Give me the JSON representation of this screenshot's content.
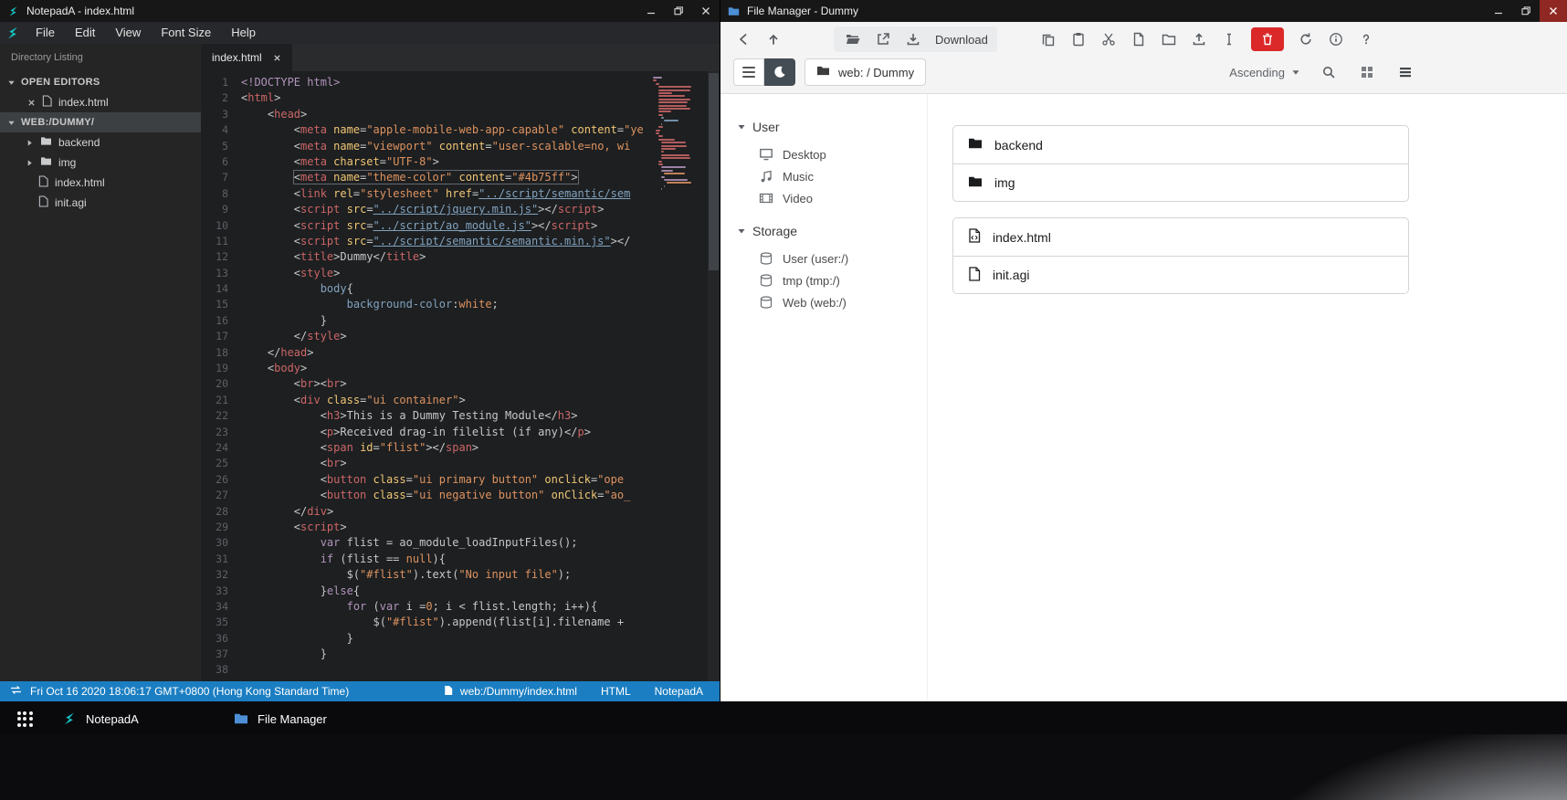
{
  "colors": {
    "statusbar_blue": "#1b7ec2",
    "danger_red": "#db2828",
    "logo_teal": "#14c4c6",
    "fm_folder_blue": "#4c8fd6",
    "token": {
      "p": "#c5c8c6",
      "tag": "#cc6666",
      "attr": "#f0c674",
      "str": "#de935f",
      "link": "#81a2be",
      "kw": "#b294bb",
      "num": "#de935f",
      "prop": "#81a2be",
      "dt": "#b294bb"
    }
  },
  "notepad": {
    "window_title": "NotepadA - index.html",
    "menu": {
      "file": "File",
      "edit": "Edit",
      "view": "View",
      "font_size": "Font Size",
      "help": "Help"
    },
    "sidebar": {
      "header": "Directory Listing",
      "open_editors": "OPEN EDITORS",
      "open_file": "index.html",
      "workspace": "WEB:/DUMMY/",
      "tree": [
        {
          "name": "backend"
        },
        {
          "name": "img"
        },
        {
          "name": "index.html"
        },
        {
          "name": "init.agi"
        }
      ]
    },
    "tab": "index.html",
    "status": {
      "time": "Fri Oct 16 2020 18:06:17 GMT+0800 (Hong Kong Standard Time)",
      "path": "web:/Dummy/index.html",
      "mode": "HTML",
      "app": "NotepadA"
    },
    "code": {
      "lines": [
        {
          "t": [
            [
              "dt",
              "<!DOCTYPE html>"
            ]
          ]
        },
        {
          "t": [
            [
              "p",
              "<"
            ],
            [
              "tag",
              "html"
            ],
            [
              "p",
              ">"
            ]
          ]
        },
        {
          "t": [
            [
              "p",
              "    <"
            ],
            [
              "tag",
              "head"
            ],
            [
              "p",
              ">"
            ]
          ]
        },
        {
          "t": [
            [
              "p",
              "        <"
            ],
            [
              "tag",
              "meta"
            ],
            [
              "p",
              " "
            ],
            [
              "attr",
              "name"
            ],
            [
              "p",
              "="
            ],
            [
              "str",
              "\"apple-mobile-web-app-capable\""
            ],
            [
              "p",
              " "
            ],
            [
              "attr",
              "content"
            ],
            [
              "p",
              "="
            ],
            [
              "str",
              "\"ye"
            ]
          ]
        },
        {
          "t": [
            [
              "p",
              "        <"
            ],
            [
              "tag",
              "meta"
            ],
            [
              "p",
              " "
            ],
            [
              "attr",
              "name"
            ],
            [
              "p",
              "="
            ],
            [
              "str",
              "\"viewport\""
            ],
            [
              "p",
              " "
            ],
            [
              "attr",
              "content"
            ],
            [
              "p",
              "="
            ],
            [
              "str",
              "\"user-scalable=no, wi"
            ]
          ]
        },
        {
          "t": [
            [
              "p",
              "        <"
            ],
            [
              "tag",
              "meta"
            ],
            [
              "p",
              " "
            ],
            [
              "attr",
              "charset"
            ],
            [
              "p",
              "="
            ],
            [
              "str",
              "\"UTF-8\""
            ],
            [
              "p",
              ">"
            ]
          ]
        },
        {
          "hl": true,
          "t": [
            [
              "p",
              "        "
            ],
            [
              "p",
              "<"
            ],
            [
              "tag",
              "meta"
            ],
            [
              "p",
              " "
            ],
            [
              "attr",
              "name"
            ],
            [
              "p",
              "="
            ],
            [
              "str",
              "\"theme-color\""
            ],
            [
              "p",
              " "
            ],
            [
              "attr",
              "content"
            ],
            [
              "p",
              "="
            ],
            [
              "str",
              "\"#4b75ff\""
            ],
            [
              "p",
              ">"
            ]
          ]
        },
        {
          "t": [
            [
              "p",
              "        <"
            ],
            [
              "tag",
              "link"
            ],
            [
              "p",
              " "
            ],
            [
              "attr",
              "rel"
            ],
            [
              "p",
              "="
            ],
            [
              "str",
              "\"stylesheet\""
            ],
            [
              "p",
              " "
            ],
            [
              "attr",
              "href"
            ],
            [
              "p",
              "="
            ],
            [
              "link",
              "\"../script/semantic/sem"
            ]
          ]
        },
        {
          "t": [
            [
              "p",
              "        <"
            ],
            [
              "tag",
              "script"
            ],
            [
              "p",
              " "
            ],
            [
              "attr",
              "src"
            ],
            [
              "p",
              "="
            ],
            [
              "link",
              "\"../script/jquery.min.js\""
            ],
            [
              "p",
              "></"
            ],
            [
              "tag",
              "script"
            ],
            [
              "p",
              ">"
            ]
          ]
        },
        {
          "t": [
            [
              "p",
              "        <"
            ],
            [
              "tag",
              "script"
            ],
            [
              "p",
              " "
            ],
            [
              "attr",
              "src"
            ],
            [
              "p",
              "="
            ],
            [
              "link",
              "\"../script/ao_module.js\""
            ],
            [
              "p",
              "></"
            ],
            [
              "tag",
              "script"
            ],
            [
              "p",
              ">"
            ]
          ]
        },
        {
          "t": [
            [
              "p",
              "        <"
            ],
            [
              "tag",
              "script"
            ],
            [
              "p",
              " "
            ],
            [
              "attr",
              "src"
            ],
            [
              "p",
              "="
            ],
            [
              "link",
              "\"../script/semantic/semantic.min.js\""
            ],
            [
              "p",
              "></"
            ]
          ]
        },
        {
          "t": [
            [
              "p",
              "        <"
            ],
            [
              "tag",
              "title"
            ],
            [
              "p",
              ">Dummy</"
            ],
            [
              "tag",
              "title"
            ],
            [
              "p",
              ">"
            ]
          ]
        },
        {
          "t": [
            [
              "p",
              "        <"
            ],
            [
              "tag",
              "style"
            ],
            [
              "p",
              ">"
            ]
          ]
        },
        {
          "t": [
            [
              "p",
              "            "
            ],
            [
              "prop",
              "body"
            ],
            [
              "p",
              "{"
            ]
          ]
        },
        {
          "t": [
            [
              "p",
              "                "
            ],
            [
              "prop",
              "background-color"
            ],
            [
              "p",
              ":"
            ],
            [
              "num",
              "white"
            ],
            [
              "p",
              ";"
            ]
          ]
        },
        {
          "t": [
            [
              "p",
              "            }"
            ]
          ]
        },
        {
          "t": [
            [
              "p",
              "        </"
            ],
            [
              "tag",
              "style"
            ],
            [
              "p",
              ">"
            ]
          ]
        },
        {
          "t": [
            [
              "p",
              "    </"
            ],
            [
              "tag",
              "head"
            ],
            [
              "p",
              ">"
            ]
          ]
        },
        {
          "t": [
            [
              "p",
              "    <"
            ],
            [
              "tag",
              "body"
            ],
            [
              "p",
              ">"
            ]
          ]
        },
        {
          "t": [
            [
              "p",
              "        <"
            ],
            [
              "tag",
              "br"
            ],
            [
              "p",
              "><"
            ],
            [
              "tag",
              "br"
            ],
            [
              "p",
              ">"
            ]
          ]
        },
        {
          "t": [
            [
              "p",
              "        <"
            ],
            [
              "tag",
              "div"
            ],
            [
              "p",
              " "
            ],
            [
              "attr",
              "class"
            ],
            [
              "p",
              "="
            ],
            [
              "str",
              "\"ui container\""
            ],
            [
              "p",
              ">"
            ]
          ]
        },
        {
          "t": [
            [
              "p",
              "            <"
            ],
            [
              "tag",
              "h3"
            ],
            [
              "p",
              ">This is a Dummy Testing Module</"
            ],
            [
              "tag",
              "h3"
            ],
            [
              "p",
              ">"
            ]
          ]
        },
        {
          "t": [
            [
              "p",
              "            <"
            ],
            [
              "tag",
              "p"
            ],
            [
              "p",
              ">Received drag-in filelist (if any)</"
            ],
            [
              "tag",
              "p"
            ],
            [
              "p",
              ">"
            ]
          ]
        },
        {
          "t": [
            [
              "p",
              "            <"
            ],
            [
              "tag",
              "span"
            ],
            [
              "p",
              " "
            ],
            [
              "attr",
              "id"
            ],
            [
              "p",
              "="
            ],
            [
              "str",
              "\"flist\""
            ],
            [
              "p",
              "></"
            ],
            [
              "tag",
              "span"
            ],
            [
              "p",
              ">"
            ]
          ]
        },
        {
          "t": [
            [
              "p",
              "            <"
            ],
            [
              "tag",
              "br"
            ],
            [
              "p",
              ">"
            ]
          ]
        },
        {
          "t": [
            [
              "p",
              "            <"
            ],
            [
              "tag",
              "button"
            ],
            [
              "p",
              " "
            ],
            [
              "attr",
              "class"
            ],
            [
              "p",
              "="
            ],
            [
              "str",
              "\"ui primary button\""
            ],
            [
              "p",
              " "
            ],
            [
              "attr",
              "onclick"
            ],
            [
              "p",
              "="
            ],
            [
              "str",
              "\"ope"
            ]
          ]
        },
        {
          "t": [
            [
              "p",
              "            <"
            ],
            [
              "tag",
              "button"
            ],
            [
              "p",
              " "
            ],
            [
              "attr",
              "class"
            ],
            [
              "p",
              "="
            ],
            [
              "str",
              "\"ui negative button\""
            ],
            [
              "p",
              " "
            ],
            [
              "attr",
              "onClick"
            ],
            [
              "p",
              "="
            ],
            [
              "str",
              "\"ao_"
            ]
          ]
        },
        {
          "t": [
            [
              "p",
              "        </"
            ],
            [
              "tag",
              "div"
            ],
            [
              "p",
              ">"
            ]
          ]
        },
        {
          "t": [
            [
              "p",
              "        <"
            ],
            [
              "tag",
              "script"
            ],
            [
              "p",
              ">"
            ]
          ]
        },
        {
          "t": [
            [
              "p",
              "            "
            ],
            [
              "kw",
              "var"
            ],
            [
              "p",
              " flist = ao_module_loadInputFiles();"
            ]
          ]
        },
        {
          "t": [
            [
              "p",
              "            "
            ],
            [
              "kw",
              "if"
            ],
            [
              "p",
              " (flist == "
            ],
            [
              "num",
              "null"
            ],
            [
              "p",
              "){"
            ]
          ]
        },
        {
          "t": [
            [
              "p",
              "                $("
            ],
            [
              "str",
              "\"#flist\""
            ],
            [
              "p",
              ").text("
            ],
            [
              "str",
              "\"No input file\""
            ],
            [
              "p",
              ");"
            ]
          ]
        },
        {
          "t": [
            [
              "p",
              "            }"
            ],
            [
              "kw",
              "else"
            ],
            [
              "p",
              "{"
            ]
          ]
        },
        {
          "t": [
            [
              "p",
              "                "
            ],
            [
              "kw",
              "for"
            ],
            [
              "p",
              " ("
            ],
            [
              "kw",
              "var"
            ],
            [
              "p",
              " i ="
            ],
            [
              "num",
              "0"
            ],
            [
              "p",
              "; i < flist.length; i++){"
            ]
          ]
        },
        {
          "t": [
            [
              "p",
              "                    $("
            ],
            [
              "str",
              "\"#flist\""
            ],
            [
              "p",
              ").append(flist[i].filename + "
            ]
          ]
        },
        {
          "t": [
            [
              "p",
              "                }"
            ]
          ]
        },
        {
          "t": [
            [
              "p",
              "            }"
            ]
          ]
        },
        {
          "t": []
        }
      ]
    }
  },
  "filemanager": {
    "window_title": "File Manager - Dummy",
    "toolbar": {
      "download": "Download"
    },
    "breadcrumb": "web: / Dummy",
    "sort": "Ascending",
    "nav": {
      "user_label": "User",
      "user_items": [
        {
          "label": "Desktop",
          "icon": "desktop-icon"
        },
        {
          "label": "Music",
          "icon": "music-icon"
        },
        {
          "label": "Video",
          "icon": "video-icon"
        }
      ],
      "storage_label": "Storage",
      "storage_items": [
        {
          "label": "User (user:/)",
          "icon": "disk-icon"
        },
        {
          "label": "tmp (tmp:/)",
          "icon": "disk-icon"
        },
        {
          "label": "Web (web:/)",
          "icon": "disk-icon"
        }
      ]
    },
    "groups": [
      {
        "items": [
          {
            "name": "backend",
            "icon": "folder-icon"
          },
          {
            "name": "img",
            "icon": "folder-icon"
          }
        ]
      },
      {
        "items": [
          {
            "name": "index.html",
            "icon": "file-code-icon"
          },
          {
            "name": "init.agi",
            "icon": "file-icon"
          }
        ]
      }
    ]
  },
  "taskbar": {
    "apps": [
      {
        "label": "NotepadA"
      },
      {
        "label": "File Manager"
      }
    ]
  }
}
